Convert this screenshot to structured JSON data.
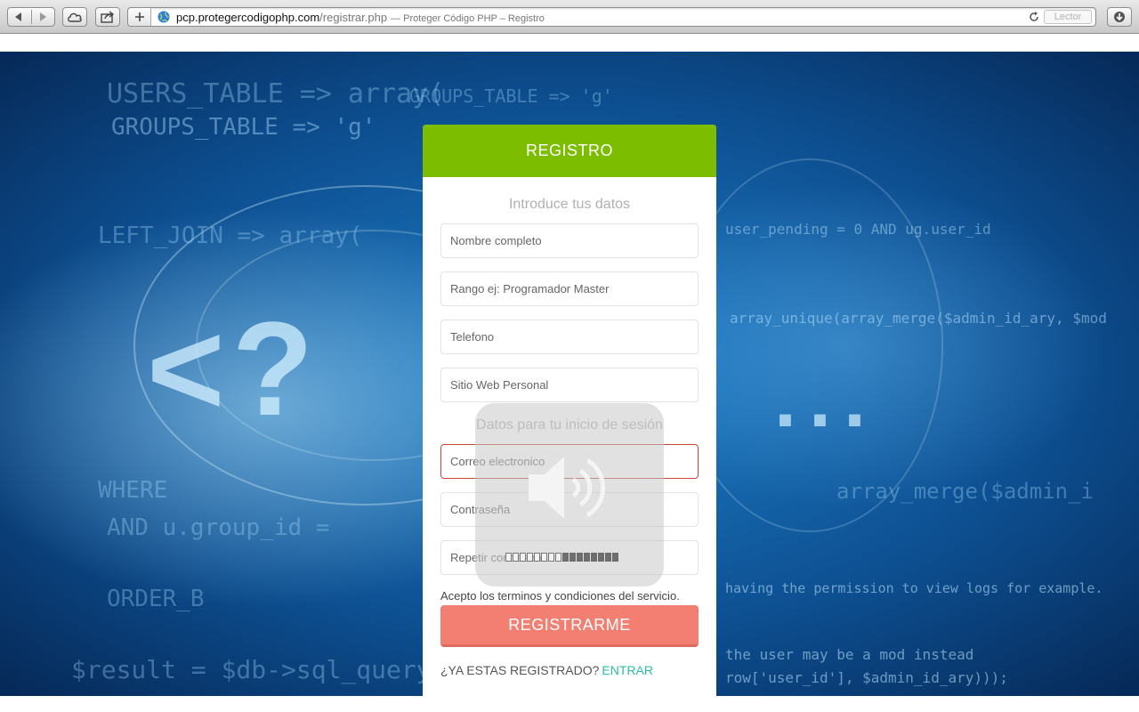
{
  "browser": {
    "url_host": "pcp.protegercodigophp.com",
    "url_path": "/registrar.php",
    "page_title": "— Proteger Código PHP – Registro",
    "reader_label": "Lector",
    "icons": [
      "back-icon",
      "forward-icon",
      "cloud-icon",
      "share-icon",
      "plus-icon",
      "globe-icon",
      "reload-icon",
      "download-icon"
    ]
  },
  "hero": {
    "big_text": "<?",
    "dots_text": "...",
    "code_lines": [
      "USERS_TABLE => array(",
      "GROUPS_TABLE => 'g'",
      "LEFT_JOIN => array(",
      "WHERE",
      "AND u.group_id =",
      "ORDER_B",
      "$result = $db->sql_query(",
      "array_unique(array_merge($admin_id_ary, $mod",
      "user_pending = 0 AND ug.user_id",
      "array_merge($admin_i",
      "having the permission to view logs for example.",
      "the user may be a mod instead",
      "row['user_id'], $admin_id_ary)));"
    ]
  },
  "form": {
    "header": "REGISTRO",
    "section_personal": "Introduce tus datos",
    "section_login": "Datos para tu inicio de sesión",
    "fields": {
      "full_name": "Nombre completo",
      "rank": "Rango ej: Programador Master",
      "phone": "Telefono",
      "website": "Sitio Web Personal",
      "email": "Correo electronico",
      "password": "Contraseña",
      "repeat_password": "Repetir contraseña"
    },
    "terms": "Acepto los terminos y condiciones del servicio.",
    "submit": "REGISTRARME",
    "already_registered": "¿YA ESTAS REGISTRADO?",
    "login_link": "ENTRAR"
  },
  "volume_overlay": {
    "icon": "speaker-volume-icon",
    "level_fraction": 0.5,
    "segments_total": 16
  },
  "colors": {
    "header_green": "#7cbd00",
    "submit_coral": "#f37f72",
    "login_link_teal": "#2bbfa4",
    "error_border": "#c9453a"
  }
}
